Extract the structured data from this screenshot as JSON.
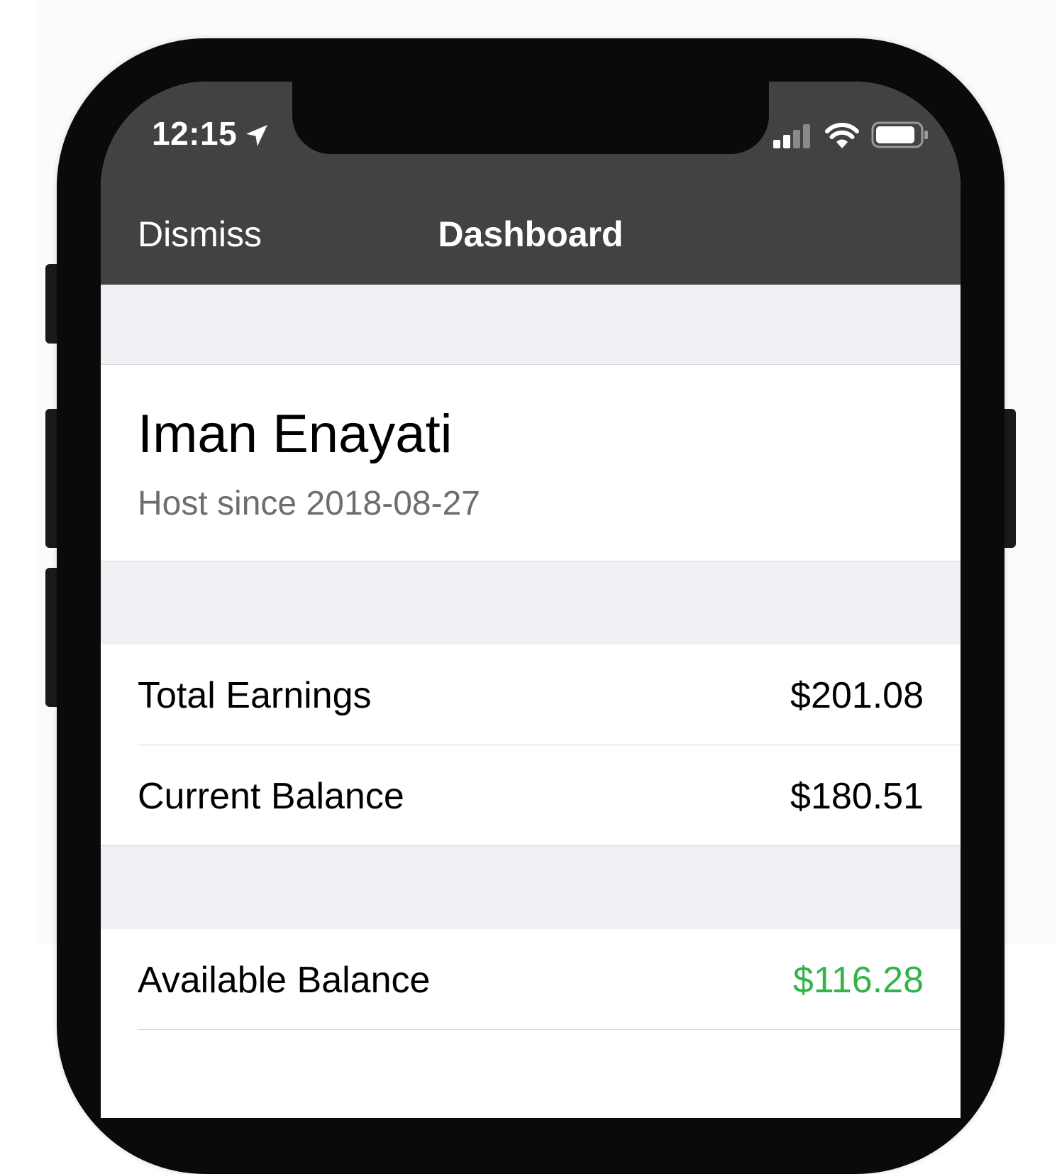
{
  "status_bar": {
    "time": "12:15",
    "location_icon": "location-arrow-icon",
    "signal_icon": "cellular-signal-icon",
    "wifi_icon": "wifi-icon",
    "battery_icon": "battery-icon"
  },
  "nav_bar": {
    "dismiss_label": "Dismiss",
    "title": "Dashboard"
  },
  "profile": {
    "name": "Iman Enayati",
    "host_since": "Host since 2018-08-27"
  },
  "earnings": [
    {
      "label": "Total Earnings",
      "value": "$201.08"
    },
    {
      "label": "Current Balance",
      "value": "$180.51"
    }
  ],
  "available": {
    "label": "Available Balance",
    "value": "$116.28"
  },
  "colors": {
    "nav_background": "#424242",
    "grouped_background": "#efeff4",
    "positive_value": "#34b34a"
  }
}
